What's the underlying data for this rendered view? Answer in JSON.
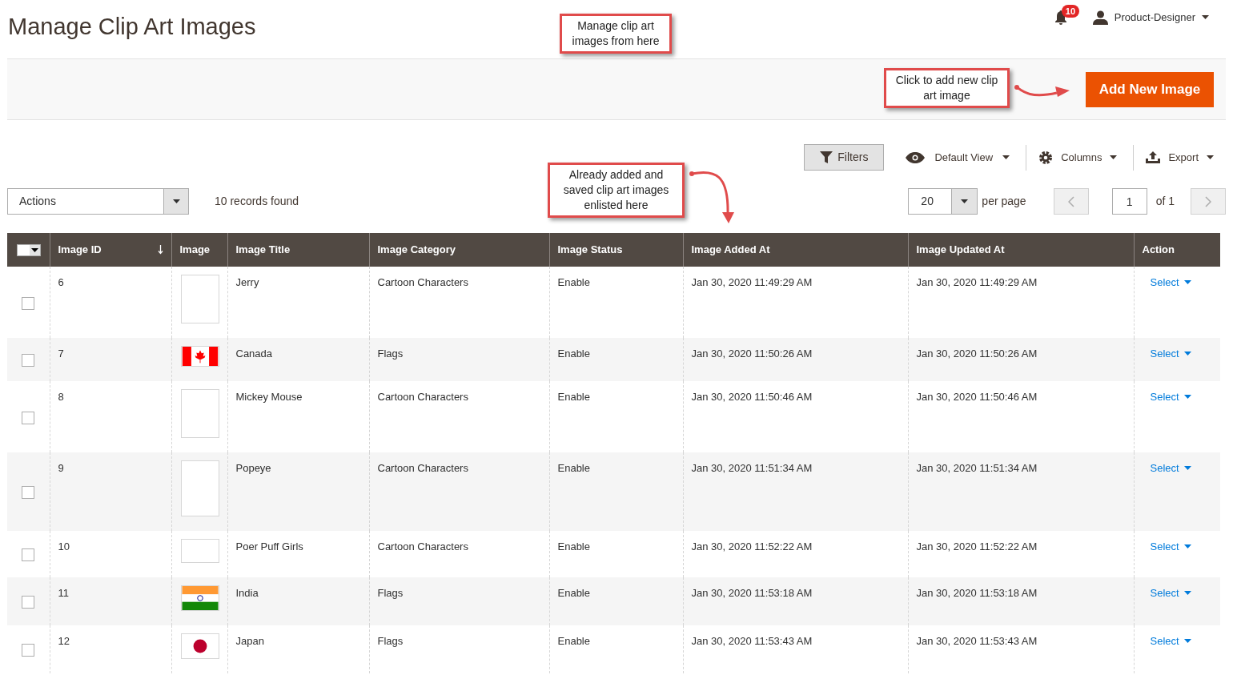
{
  "page_title": "Manage Clip Art Images",
  "header": {
    "notifications_count": "10",
    "user": "Product-Designer"
  },
  "callouts": [
    {
      "text": "Manage clip art images from here"
    },
    {
      "text": "Click to add new clip art image"
    },
    {
      "text": "Already added and saved clip art images enlisted here"
    }
  ],
  "add_button": "Add New Image",
  "toolbar": {
    "filters": "Filters",
    "view": "Default View",
    "columns": "Columns",
    "export": "Export"
  },
  "actions_select": "Actions",
  "records_found": "10 records found",
  "pagination": {
    "per_page_value": "20",
    "per_page_label": "per page",
    "page": "1",
    "of": "of 1"
  },
  "table": {
    "select_all_checked": false,
    "columns": [
      "Image ID",
      "Image",
      "Image Title",
      "Image Category",
      "Image Status",
      "Image Added At",
      "Image Updated At",
      "Action"
    ],
    "rows": [
      {
        "id": "6",
        "kind": "character_tall",
        "title": "Jerry",
        "category": "Cartoon Characters",
        "status": "Enable",
        "added": "Jan 30, 2020 11:49:29 AM",
        "updated": "Jan 30, 2020 11:49:29 AM",
        "action": "Select",
        "checked": false
      },
      {
        "id": "7",
        "kind": "flag_canada",
        "title": "Canada",
        "category": "Flags",
        "status": "Enable",
        "added": "Jan 30, 2020 11:50:26 AM",
        "updated": "Jan 30, 2020 11:50:26 AM",
        "action": "Select",
        "checked": false
      },
      {
        "id": "8",
        "kind": "character_tall",
        "title": "Mickey Mouse",
        "category": "Cartoon Characters",
        "status": "Enable",
        "added": "Jan 30, 2020 11:50:46 AM",
        "updated": "Jan 30, 2020 11:50:46 AM",
        "action": "Select",
        "checked": false
      },
      {
        "id": "9",
        "kind": "character_taller",
        "title": "Popeye",
        "category": "Cartoon Characters",
        "status": "Enable",
        "added": "Jan 30, 2020 11:51:34 AM",
        "updated": "Jan 30, 2020 11:51:34 AM",
        "action": "Select",
        "checked": false
      },
      {
        "id": "10",
        "kind": "character_wide",
        "title": "Poer Puff Girls",
        "category": "Cartoon Characters",
        "status": "Enable",
        "added": "Jan 30, 2020 11:52:22 AM",
        "updated": "Jan 30, 2020 11:52:22 AM",
        "action": "Select",
        "checked": false
      },
      {
        "id": "11",
        "kind": "flag_india",
        "title": "India",
        "category": "Flags",
        "status": "Enable",
        "added": "Jan 30, 2020 11:53:18 AM",
        "updated": "Jan 30, 2020 11:53:18 AM",
        "action": "Select",
        "checked": false
      },
      {
        "id": "12",
        "kind": "flag_japan",
        "title": "Japan",
        "category": "Flags",
        "status": "Enable",
        "added": "Jan 30, 2020 11:53:43 AM",
        "updated": "Jan 30, 2020 11:53:43 AM",
        "action": "Select",
        "checked": false
      }
    ]
  }
}
